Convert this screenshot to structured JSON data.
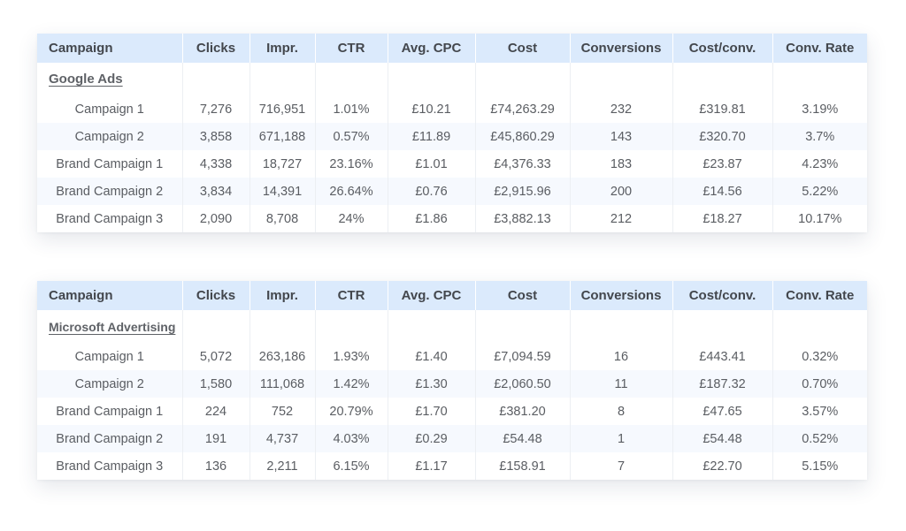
{
  "headers": [
    "Campaign",
    "Clicks",
    "Impr.",
    "CTR",
    "Avg. CPC",
    "Cost",
    "Conversions",
    "Cost/conv.",
    "Conv. Rate"
  ],
  "tables": [
    {
      "group": "Google Ads",
      "rows": [
        [
          "Campaign 1",
          "7,276",
          "716,951",
          "1.01%",
          "£10.21",
          "£74,263.29",
          "232",
          "£319.81",
          "3.19%"
        ],
        [
          "Campaign 2",
          "3,858",
          "671,188",
          "0.57%",
          "£11.89",
          "£45,860.29",
          "143",
          "£320.70",
          "3.7%"
        ],
        [
          "Brand Campaign 1",
          "4,338",
          "18,727",
          "23.16%",
          "£1.01",
          "£4,376.33",
          "183",
          "£23.87",
          "4.23%"
        ],
        [
          "Brand Campaign 2",
          "3,834",
          "14,391",
          "26.64%",
          "£0.76",
          "£2,915.96",
          "200",
          "£14.56",
          "5.22%"
        ],
        [
          "Brand Campaign 3",
          "2,090",
          "8,708",
          "24%",
          "£1.86",
          "£3,882.13",
          "212",
          "£18.27",
          "10.17%"
        ]
      ]
    },
    {
      "group": "Microsoft Advertising",
      "rows": [
        [
          "Campaign 1",
          "5,072",
          "263,186",
          "1.93%",
          "£1.40",
          "£7,094.59",
          "16",
          "£443.41",
          "0.32%"
        ],
        [
          "Campaign 2",
          "1,580",
          "111,068",
          "1.42%",
          "£1.30",
          "£2,060.50",
          "11",
          "£187.32",
          "0.70%"
        ],
        [
          "Brand Campaign 1",
          "224",
          "752",
          "20.79%",
          "£1.70",
          "£381.20",
          "8",
          "£47.65",
          "3.57%"
        ],
        [
          "Brand Campaign 2",
          "191",
          "4,737",
          "4.03%",
          "£0.29",
          "£54.48",
          "1",
          "£54.48",
          "0.52%"
        ],
        [
          "Brand Campaign 3",
          "136",
          "2,211",
          "6.15%",
          "£1.17",
          "£158.91",
          "7",
          "£22.70",
          "5.15%"
        ]
      ]
    }
  ]
}
